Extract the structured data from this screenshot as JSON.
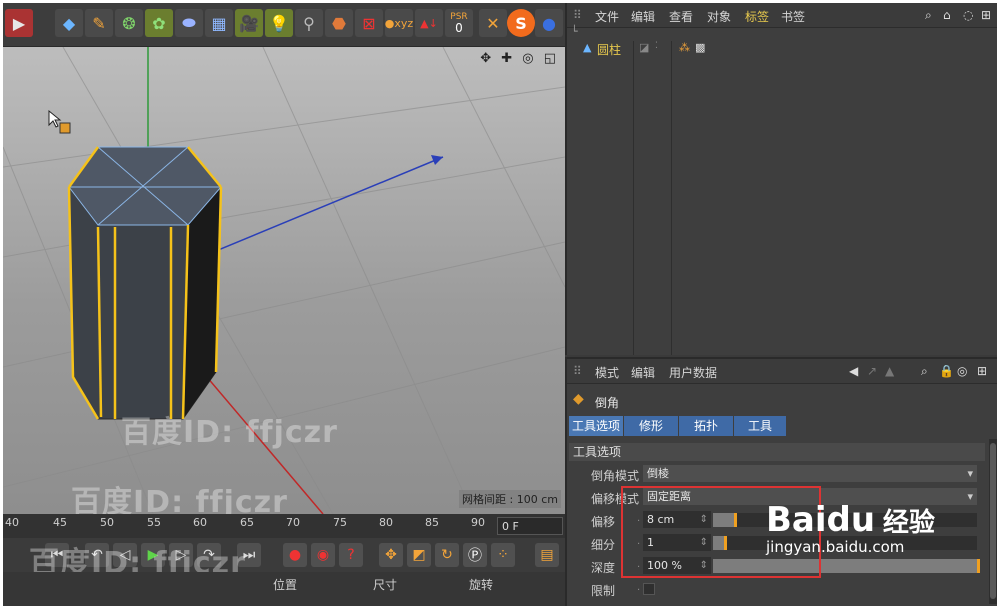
{
  "colors": {
    "accent": "#e6c84d",
    "tab_blue": "#4a78b4",
    "slider_handle": "#f0a020",
    "highlight_box": "#dd3333"
  },
  "toolbar": {
    "icons": [
      "cube-icon",
      "pen-icon",
      "subdivision-icon",
      "array-icon",
      "deformer-icon",
      "floor-icon",
      "camera-icon",
      "light-icon",
      "figure-icon",
      "tag-icon",
      "render-icon",
      "xyz-coord-icon",
      "axis-icon"
    ],
    "psr_label": "PSR",
    "psr_value": "0"
  },
  "viewport": {
    "grid_spacing": "网格间距 : 100 cm",
    "nav_icons": "✥ ✚ ◎ ◱"
  },
  "watermarks": [
    "百度ID: ffjczr",
    "百度ID: ffjczr",
    "百度ID: ffjczr"
  ],
  "timeline": {
    "ticks": [
      "40",
      "45",
      "50",
      "55",
      "60",
      "65",
      "70",
      "75",
      "80",
      "85",
      "90"
    ],
    "current_frame": "0 F"
  },
  "coords": {
    "position": "位置",
    "size": "尺寸",
    "rotation": "旋转"
  },
  "object_manager": {
    "menu": [
      "文件",
      "编辑",
      "查看",
      "对象",
      "标签",
      "书签"
    ],
    "active_menu": "标签",
    "object_name": "圆柱"
  },
  "attribute_manager": {
    "menu": [
      "模式",
      "编辑",
      "用户数据"
    ],
    "title": "倒角",
    "tabs": [
      "工具选项",
      "修形",
      "拓扑",
      "工具"
    ],
    "section": "工具选项",
    "params": {
      "bevel_mode": {
        "label": "倒角模式",
        "value": "倒棱"
      },
      "offset_mode": {
        "label": "偏移模式",
        "value": "固定距离"
      },
      "offset": {
        "label": "偏移",
        "value": "8 cm",
        "fill": 0.08
      },
      "subdivision": {
        "label": "细分",
        "value": "1",
        "fill": 0.04
      },
      "depth": {
        "label": "深度",
        "value": "100 %",
        "fill": 1.0
      },
      "limit": {
        "label": "限制"
      }
    }
  },
  "brand": {
    "baidu": "Baidu",
    "jingyan": "经验",
    "url": "jingyan.baidu.com"
  }
}
